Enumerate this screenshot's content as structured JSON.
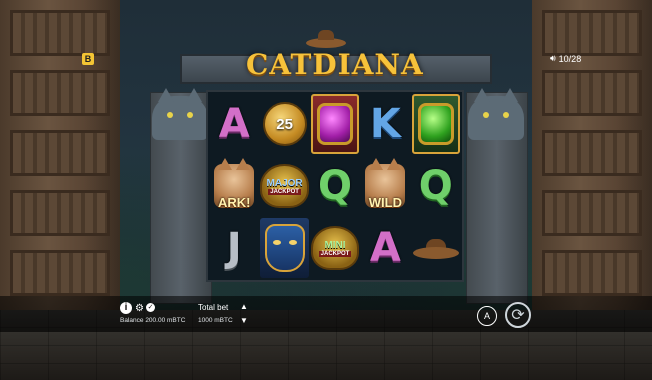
{
  "game": {
    "title": "CATDIANA",
    "provider_badge": "B"
  },
  "top_right": {
    "sound_icon": "speaker-icon",
    "counter": "10/28"
  },
  "reels": [
    [
      {
        "sym": "A",
        "kind": "letter"
      },
      {
        "sym": "cat-ark",
        "kind": "cat",
        "label": "ARK!"
      },
      {
        "sym": "J",
        "kind": "letter"
      }
    ],
    [
      {
        "sym": "coin",
        "kind": "coin",
        "label": "25"
      },
      {
        "sym": "major",
        "kind": "jackpot",
        "label": "MAJOR",
        "sub": "JACKPOT",
        "tone": "blue"
      },
      {
        "sym": "mask",
        "kind": "mask"
      }
    ],
    [
      {
        "sym": "gem-purple",
        "kind": "gem"
      },
      {
        "sym": "Q",
        "kind": "letter"
      },
      {
        "sym": "mini",
        "kind": "jackpot",
        "label": "MINI",
        "sub": "JACKPOT",
        "tone": "green"
      }
    ],
    [
      {
        "sym": "K",
        "kind": "letter"
      },
      {
        "sym": "wild",
        "kind": "wild",
        "label": "WILD"
      },
      {
        "sym": "A",
        "kind": "letter"
      }
    ],
    [
      {
        "sym": "gem-green",
        "kind": "gem-green"
      },
      {
        "sym": "Q",
        "kind": "letter"
      },
      {
        "sym": "hat",
        "kind": "hat"
      }
    ]
  ],
  "bottom_bar": {
    "balance_label": "Balance",
    "balance_value": "200.00 mBTC",
    "total_bet_label": "Total bet",
    "total_bet_value": "1000 mBTC",
    "auto_label": "A",
    "spin_icon": "spin-arrows-icon",
    "info_icon": "info-icon",
    "settings_icon": "gear-icon",
    "fair_icon": "check-icon"
  }
}
